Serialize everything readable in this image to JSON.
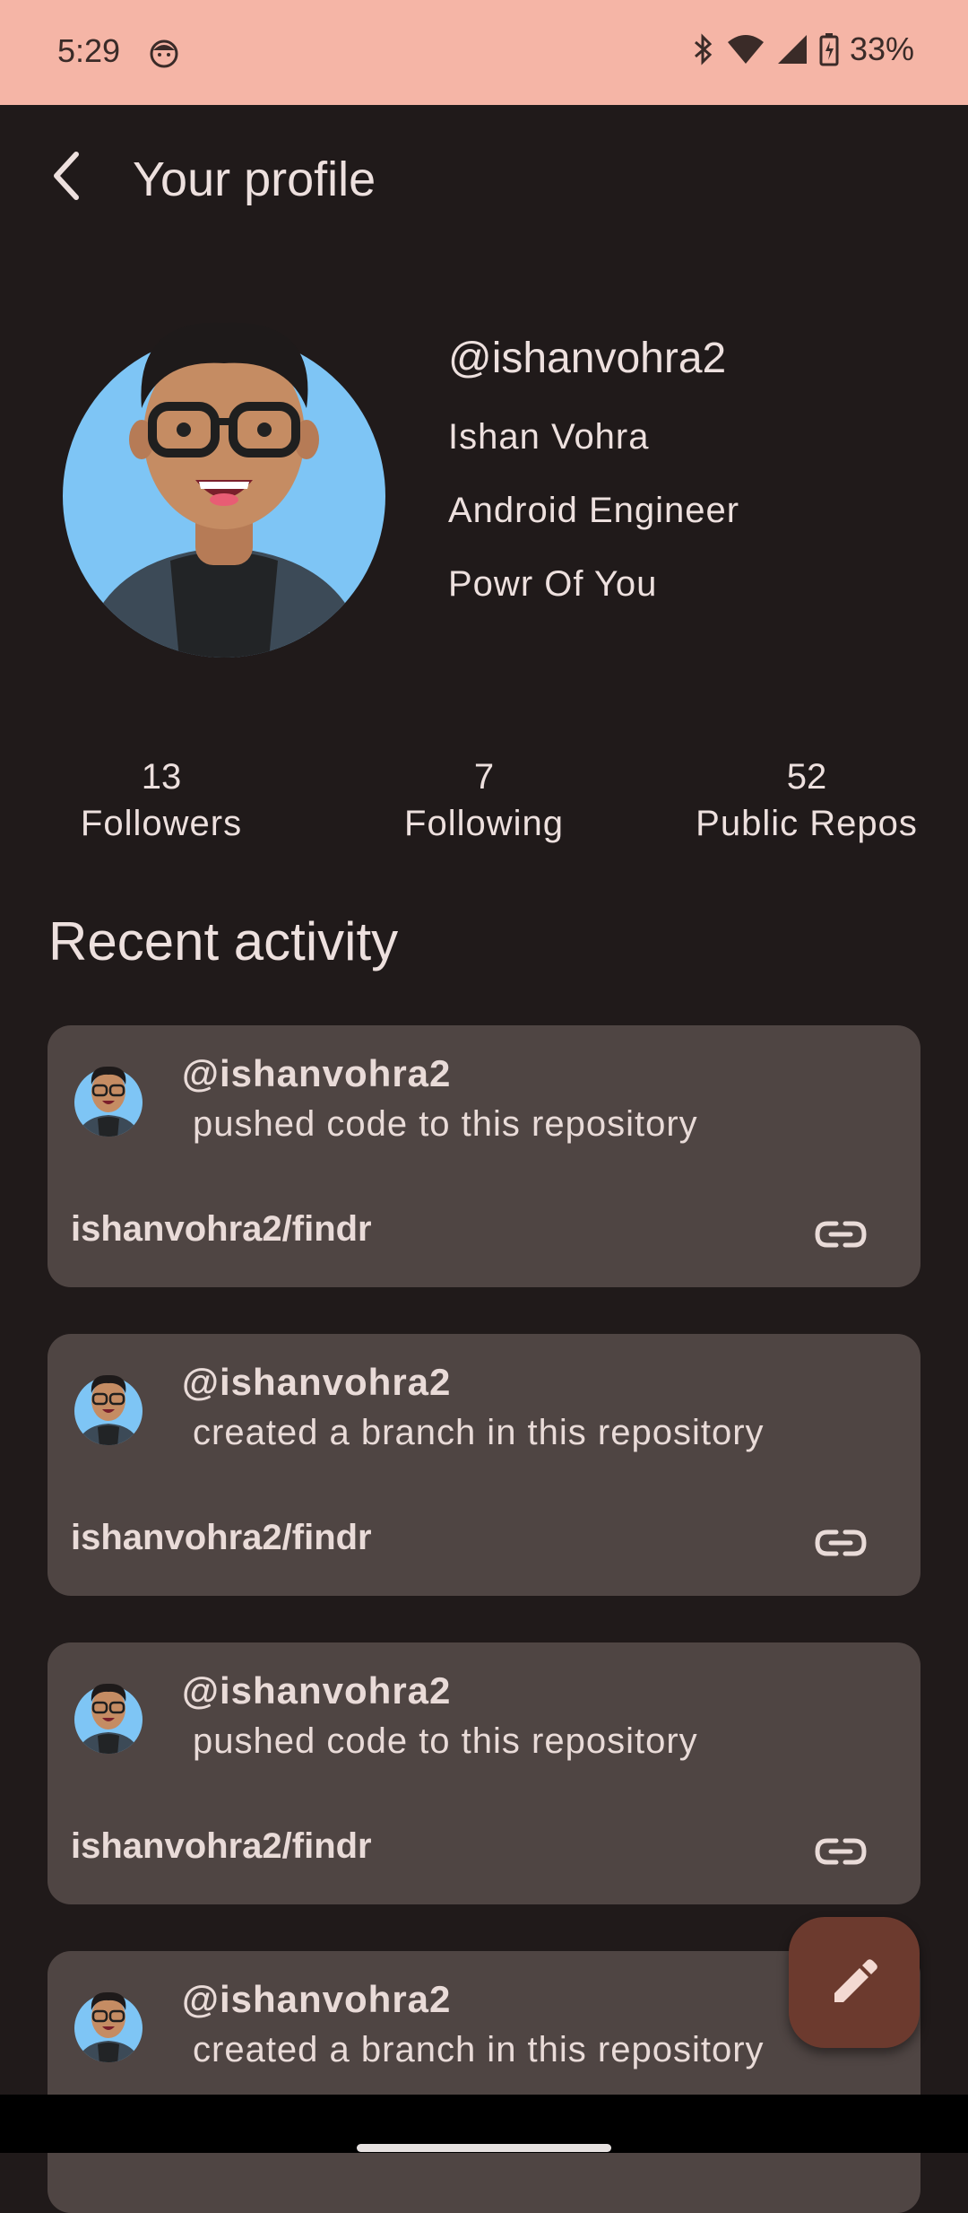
{
  "status_bar": {
    "time": "5:29",
    "battery": "33%",
    "icons": [
      "face-icon",
      "bluetooth-icon",
      "wifi-icon",
      "signal-icon",
      "battery-icon"
    ]
  },
  "app_bar": {
    "title": "Your profile",
    "back_icon": "back-arrow-icon"
  },
  "profile": {
    "handle": "@ishanvohra2",
    "name": "Ishan Vohra",
    "title": "Android Engineer",
    "company": "Powr Of You"
  },
  "stats": [
    {
      "value": "13",
      "label": "Followers"
    },
    {
      "value": "7",
      "label": "Following"
    },
    {
      "value": "52",
      "label": "Public Repos"
    }
  ],
  "recent_activity": {
    "title": "Recent activity",
    "items": [
      {
        "user": "@ishanvohra2",
        "action": "pushed code to this repository",
        "repo": "ishanvohra2/findr"
      },
      {
        "user": "@ishanvohra2",
        "action": "created a branch in this repository",
        "repo": "ishanvohra2/findr"
      },
      {
        "user": "@ishanvohra2",
        "action": "pushed code to this repository",
        "repo": "ishanvohra2/findr"
      },
      {
        "user": "@ishanvohra2",
        "action": "created a branch in this repository",
        "repo": ""
      }
    ]
  },
  "fab": {
    "icon": "edit-pencil-icon"
  },
  "colors": {
    "status_bar": "#f5b5a6",
    "background": "#201a1a",
    "card": "#4f4543",
    "fab": "#6c3a2e",
    "text": "#ede0de"
  }
}
